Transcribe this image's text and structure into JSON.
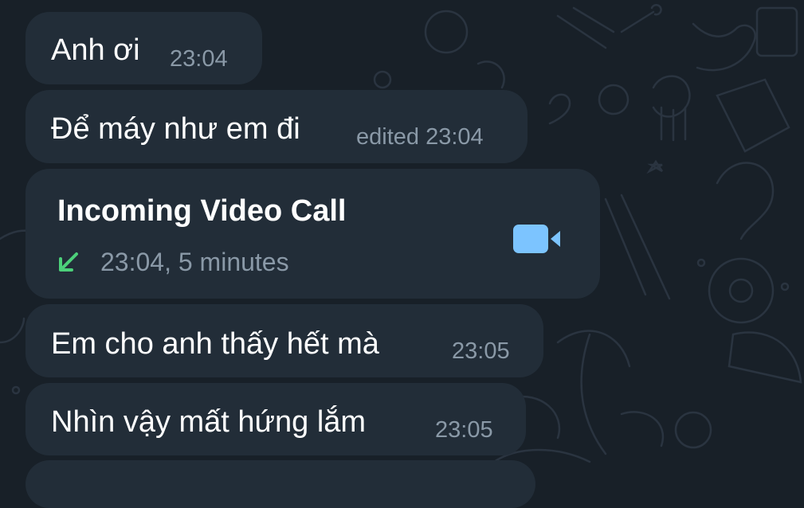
{
  "messages": [
    {
      "text": "Anh ơi",
      "time": "23:04"
    },
    {
      "text": "Để máy như em đi",
      "time": "edited 23:04"
    },
    {
      "text": "Em cho anh thấy hết mà",
      "time": "23:05"
    },
    {
      "text": "Nhìn vậy mất hứng lắm",
      "time": "23:05"
    }
  ],
  "call": {
    "title": "Incoming Video Call",
    "meta": "23:04, 5 minutes",
    "direction_icon": "incoming-arrow-icon",
    "action_icon": "video-camera-icon"
  },
  "colors": {
    "background": "#182028",
    "bubble": "#222d38",
    "text": "#ffffff",
    "time": "#8a99a7",
    "incoming_arrow": "#4cd07a",
    "camera": "#7cc4ff"
  }
}
